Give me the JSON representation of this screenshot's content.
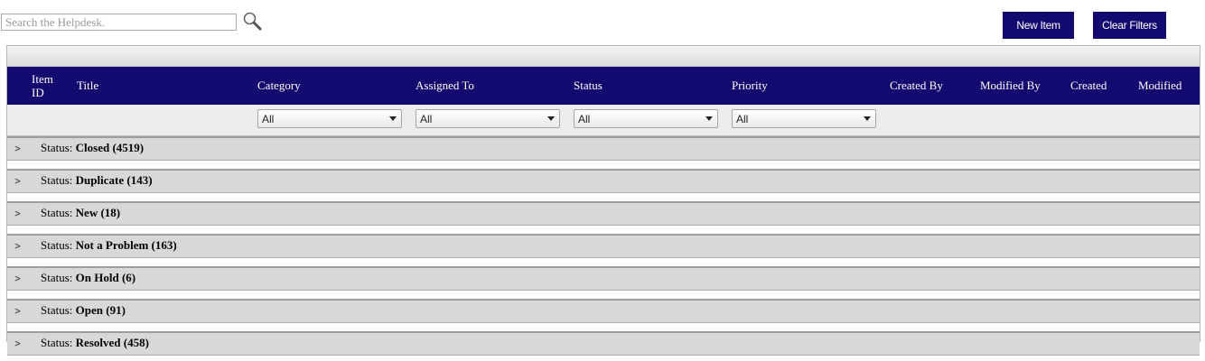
{
  "search": {
    "placeholder": "Search the Helpdesk."
  },
  "toolbar": {
    "new_item_label": "New Item",
    "clear_filters_label": "Clear Filters"
  },
  "columns": [
    "Item ID",
    "Title",
    "Category",
    "Assigned To",
    "Status",
    "Priority",
    "Created By",
    "Modified By",
    "Created",
    "Modified"
  ],
  "column_display": {
    "item_id_line1": "Item",
    "item_id_line2": "ID",
    "created_by": "Created By"
  },
  "filters": {
    "category": "All",
    "assigned_to": "All",
    "status": "All",
    "priority": "All"
  },
  "groups": [
    {
      "prefix": "Status:",
      "name": "Closed",
      "count": "(4519)"
    },
    {
      "prefix": "Status:",
      "name": "Duplicate",
      "count": "(143)"
    },
    {
      "prefix": "Status:",
      "name": "New",
      "count": "(18)"
    },
    {
      "prefix": "Status:",
      "name": "Not a Problem",
      "count": "(163)"
    },
    {
      "prefix": "Status:",
      "name": "On Hold",
      "count": "(6)"
    },
    {
      "prefix": "Status:",
      "name": "Open",
      "count": "(91)"
    },
    {
      "prefix": "Status:",
      "name": "Resolved",
      "count": "(458)"
    }
  ],
  "colors": {
    "header_bg": "#120a6e",
    "button_bg": "#120a6e",
    "group_bg": "#d8d8d8"
  },
  "icons": {
    "search": "magnifier-icon",
    "expand": "chevron-right-icon",
    "dropdown": "chevron-down-icon"
  }
}
